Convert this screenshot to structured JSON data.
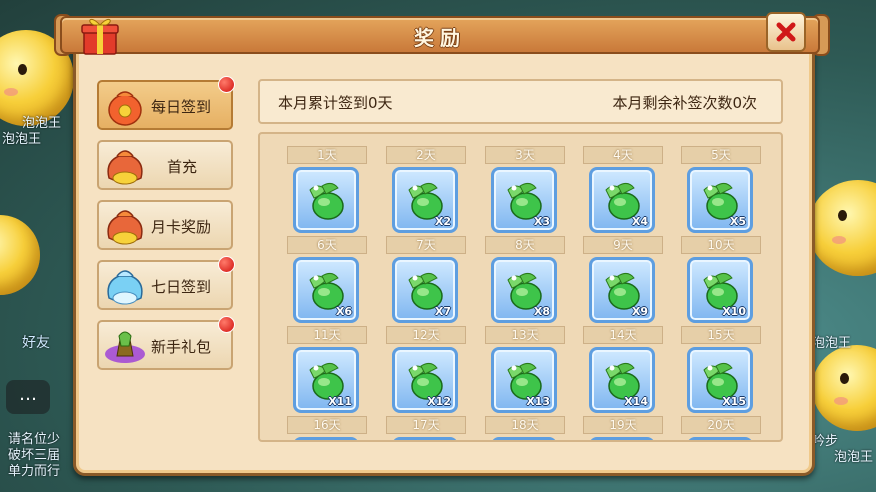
{
  "window": {
    "title": "奖励"
  },
  "background": {
    "labels": [
      "泡泡王",
      "泡泡王",
      "好友",
      "请名位少",
      "破坏三届",
      "单力而行",
      "泡泡王",
      "泡泡王",
      "吟步"
    ]
  },
  "menu": [
    {
      "label": "每日签到",
      "icon": "red-pouch-icon",
      "active": true,
      "badge": true
    },
    {
      "label": "首充",
      "icon": "gold-coin-bag-icon",
      "active": false,
      "badge": false
    },
    {
      "label": "月卡奖励",
      "icon": "gold-coin-bag-icon",
      "active": false,
      "badge": false
    },
    {
      "label": "七日签到",
      "icon": "blue-crystal-bag-icon",
      "active": false,
      "badge": true
    },
    {
      "label": "新手礼包",
      "icon": "purple-gem-chest-icon",
      "active": false,
      "badge": true
    }
  ],
  "info": {
    "left": "本月累计签到0天",
    "right": "本月剩余补签次数0次"
  },
  "days": [
    {
      "label": "1天",
      "qty": ""
    },
    {
      "label": "2天",
      "qty": "X2"
    },
    {
      "label": "3天",
      "qty": "X3"
    },
    {
      "label": "4天",
      "qty": "X4"
    },
    {
      "label": "5天",
      "qty": "X5"
    },
    {
      "label": "6天",
      "qty": "X6"
    },
    {
      "label": "7天",
      "qty": "X7"
    },
    {
      "label": "8天",
      "qty": "X8"
    },
    {
      "label": "9天",
      "qty": "X9"
    },
    {
      "label": "10天",
      "qty": "X10"
    },
    {
      "label": "11天",
      "qty": "X11"
    },
    {
      "label": "12天",
      "qty": "X12"
    },
    {
      "label": "13天",
      "qty": "X13"
    },
    {
      "label": "14天",
      "qty": "X14"
    },
    {
      "label": "15天",
      "qty": "X15"
    },
    {
      "label": "16天",
      "qty": ""
    },
    {
      "label": "17天",
      "qty": ""
    },
    {
      "label": "18天",
      "qty": ""
    },
    {
      "label": "19天",
      "qty": ""
    },
    {
      "label": "20天",
      "qty": ""
    }
  ],
  "reward_icon": "green-gourd-pouch-icon",
  "colors": {
    "accent": "#c9793a",
    "badge": "#d0100c",
    "slot_border": "#5e9ee0"
  }
}
